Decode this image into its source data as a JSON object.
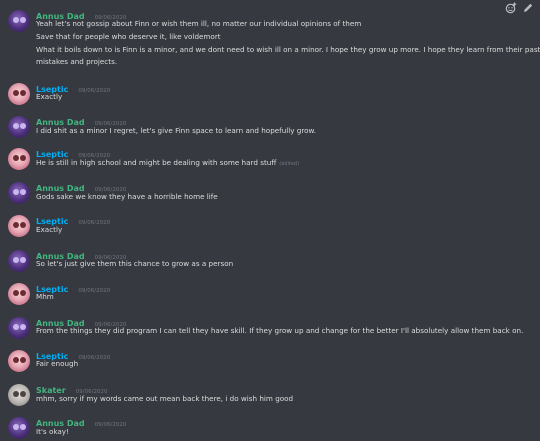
{
  "messages": [
    {
      "author": "Annus Dad",
      "date": "09/06/2020",
      "lines": [
        "Yeah let's not gossip about Finn or wish them ill, no matter our individual opinions of them",
        "Save that for people who deserve it, like voldemort",
        "What it boils down to is Finn is a minor, and we dont need to wish ill on a minor. I hope they grow up more. I hope they learn from their past",
        "mistakes and projects."
      ]
    },
    {
      "author": "Lseptic",
      "date": "09/06/2020",
      "lines": [
        "Exactly"
      ]
    },
    {
      "author": "Annus Dad",
      "date": "09/06/2020",
      "lines": [
        "I did shit as a minor I regret, let's give Finn space to learn and hopefully grow."
      ]
    },
    {
      "author": "Lseptic",
      "date": "09/06/2020",
      "lines": [
        "He is still in high school and might be dealing with some hard stuff"
      ],
      "edited": "(edited)"
    },
    {
      "author": "Annus Dad",
      "date": "09/06/2020",
      "lines": [
        "Gods sake we know they have a horrible home life"
      ]
    },
    {
      "author": "Lseptic",
      "date": "09/06/2020",
      "lines": [
        "Exactly"
      ]
    },
    {
      "author": "Annus Dad",
      "date": "09/06/2020",
      "lines": [
        "So let's just give them this chance to grow as a person"
      ]
    },
    {
      "author": "Lseptic",
      "date": "09/06/2020",
      "lines": [
        "Mhm"
      ]
    },
    {
      "author": "Annus Dad",
      "date": "09/06/2020",
      "lines": [
        "From the things they did program I can tell they have skill. If they grow up and change for the better I'll absolutely allow them back on."
      ]
    },
    {
      "author": "Lseptic",
      "date": "09/06/2020",
      "lines": [
        "Fair enough"
      ]
    },
    {
      "author": "Skater",
      "date": "09/06/2020",
      "lines": [
        "mhm, sorry if my words came out mean back there, i do wish him good"
      ]
    },
    {
      "author": "Annus Dad",
      "date": "09/06/2020",
      "lines": [
        "It's okay!"
      ]
    }
  ],
  "toolbar": {
    "icons": [
      "add-reaction-icon",
      "edit-icon"
    ]
  },
  "colors": {
    "background": "#36393f",
    "annus_dad": "#43b581",
    "lseptic": "#00aff4",
    "skater": "#43b581",
    "text": "#dcddde",
    "timestamp": "#72767d"
  }
}
